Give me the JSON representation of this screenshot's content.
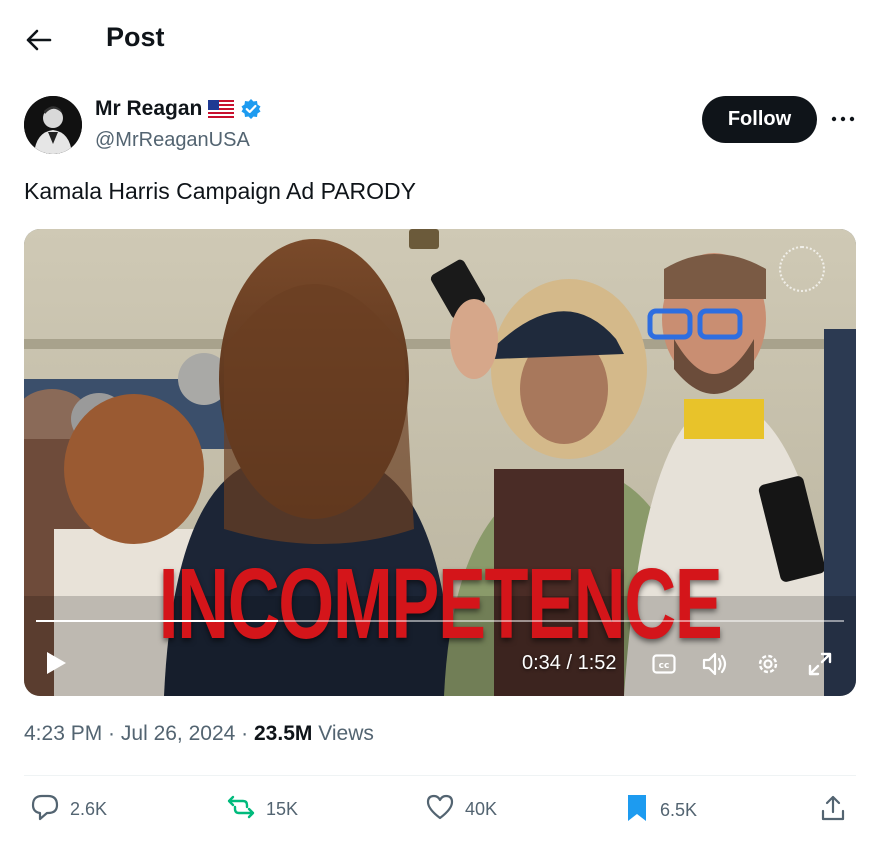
{
  "header": {
    "title": "Post"
  },
  "author": {
    "name": "Mr Reagan",
    "handle": "@MrReaganUSA",
    "follow_label": "Follow"
  },
  "tweet": {
    "text": "Kamala Harris Campaign Ad PARODY"
  },
  "video": {
    "overlay_text": "INCOMPETENCE",
    "time": "0:34 / 1:52",
    "progress": 0.3
  },
  "meta": {
    "time": "4:23 PM",
    "date": "Jul 26, 2024",
    "views_count": "23.5M",
    "views_label": "Views"
  },
  "actions": {
    "replies": "2.6K",
    "reposts": "15K",
    "likes": "40K",
    "bookmarks": "6.5K"
  },
  "colors": {
    "repost_accent": "#00ba7c",
    "bookmark_accent": "#1d9bf0",
    "verified": "#1d9bf0",
    "overlay_red": "#d4151a"
  }
}
